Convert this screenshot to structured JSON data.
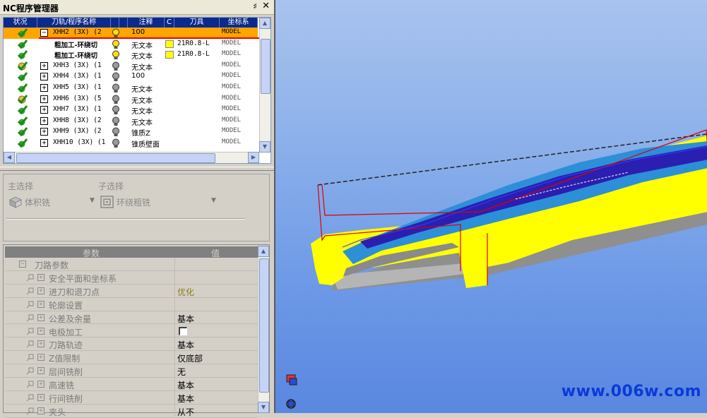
{
  "panel": {
    "title": "NC程序管理器",
    "pin": "♯",
    "close": "✕"
  },
  "nc_table": {
    "headers": [
      "状况",
      "刀轨/程序名称",
      "",
      "",
      "注释",
      "C",
      "刀具",
      "坐标系"
    ],
    "rows": [
      {
        "status": "ok",
        "expander": "−",
        "indent": 0,
        "name": "XHH2 (3X) (2",
        "bulb": "on",
        "note": "100",
        "color": false,
        "tool": "",
        "coord": "MODEL",
        "selected": true
      },
      {
        "status": "ok",
        "expander": "",
        "indent": 1,
        "name": "粗加工-环绕切",
        "bulb": "on",
        "note": "无文本",
        "color": true,
        "tool": "21R0.8-L",
        "coord": "MODEL",
        "selected": false,
        "bold": true
      },
      {
        "status": "ok",
        "expander": "",
        "indent": 1,
        "name": "粗加工-环绕切",
        "bulb": "on",
        "note": "无文本",
        "color": true,
        "tool": "21R0.8-L",
        "coord": "MODEL",
        "selected": false,
        "bold": true
      },
      {
        "status": "warn",
        "expander": "+",
        "indent": 0,
        "name": "XHH3 (3X) (1",
        "bulb": "off",
        "note": "无文本",
        "color": false,
        "tool": "",
        "coord": "MODEL",
        "selected": false
      },
      {
        "status": "ok",
        "expander": "+",
        "indent": 0,
        "name": "XHH4 (3X) (1",
        "bulb": "off",
        "note": "100",
        "color": false,
        "tool": "",
        "coord": "MODEL",
        "selected": false
      },
      {
        "status": "ok",
        "expander": "+",
        "indent": 0,
        "name": "XHH5 (3X) (1",
        "bulb": "off",
        "note": "无文本",
        "color": false,
        "tool": "",
        "coord": "MODEL",
        "selected": false
      },
      {
        "status": "warn",
        "expander": "+",
        "indent": 0,
        "name": "XHH6 (3X) (5",
        "bulb": "off",
        "note": "无文本",
        "color": false,
        "tool": "",
        "coord": "MODEL",
        "selected": false
      },
      {
        "status": "ok",
        "expander": "+",
        "indent": 0,
        "name": "XHH7 (3X) (1",
        "bulb": "off",
        "note": "无文本",
        "color": false,
        "tool": "",
        "coord": "MODEL",
        "selected": false
      },
      {
        "status": "ok",
        "expander": "+",
        "indent": 0,
        "name": "XHH8 (3X) (2",
        "bulb": "off",
        "note": "无文本",
        "color": false,
        "tool": "",
        "coord": "MODEL",
        "selected": false
      },
      {
        "status": "ok",
        "expander": "+",
        "indent": 0,
        "name": "XHH9 (3X) (2",
        "bulb": "off",
        "note": "锥质Z",
        "color": false,
        "tool": "",
        "coord": "MODEL",
        "selected": false
      },
      {
        "status": "ok",
        "expander": "+",
        "indent": 0,
        "name": "XHH10 (3X) (1",
        "bulb": "off",
        "note": "锥质壁面",
        "color": false,
        "tool": "",
        "coord": "MODEL",
        "selected": false
      }
    ]
  },
  "selection": {
    "main_label": "主选择",
    "main_value": "体积铣",
    "sub_label": "子选择",
    "sub_value": "环绕粗铣"
  },
  "params": {
    "col_param": "参数",
    "col_value": "值",
    "group": "刀路参数",
    "group_expander": "−",
    "rows": [
      {
        "label": "安全平面和坐标系",
        "value": "",
        "checkbox": false,
        "olive": false
      },
      {
        "label": "进刀和退刀点",
        "value": "优化",
        "checkbox": false,
        "olive": true
      },
      {
        "label": "轮廓设置",
        "value": "",
        "checkbox": false,
        "olive": false
      },
      {
        "label": "公差及余量",
        "value": "基本",
        "checkbox": false,
        "olive": false
      },
      {
        "label": "电极加工",
        "value": "",
        "checkbox": true,
        "olive": false
      },
      {
        "label": "刀路轨迹",
        "value": "基本",
        "checkbox": false,
        "olive": false
      },
      {
        "label": "Z值限制",
        "value": "仅底部",
        "checkbox": false,
        "olive": false
      },
      {
        "label": "层间铣削",
        "value": "无",
        "checkbox": false,
        "olive": false
      },
      {
        "label": "高速铣",
        "value": "基本",
        "checkbox": false,
        "olive": false
      },
      {
        "label": "行间铣削",
        "value": "基本",
        "checkbox": false,
        "olive": false
      },
      {
        "label": "夹头",
        "value": "从不",
        "checkbox": false,
        "olive": false
      }
    ]
  },
  "viewport": {
    "watermark": "www.006w.com"
  },
  "colors": {
    "selection": "#ffa500",
    "header": "#0a2a8c",
    "part": "#ffff00",
    "toolpath": "#2a1fb0",
    "viewport": "#7aa3e8"
  }
}
